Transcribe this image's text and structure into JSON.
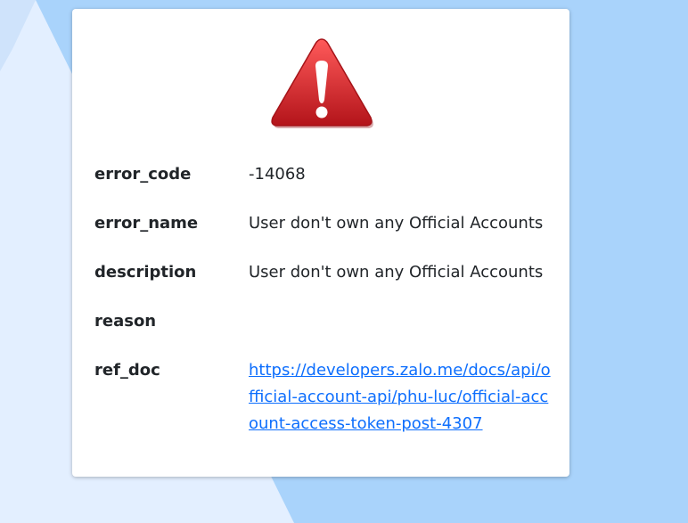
{
  "error": {
    "icon": "warning-icon",
    "rows": [
      {
        "label": "error_code",
        "value": "-14068"
      },
      {
        "label": "error_name",
        "value": "User don't own any Official Accounts"
      },
      {
        "label": "description",
        "value": "User don't own any Official Accounts"
      },
      {
        "label": "reason",
        "value": ""
      },
      {
        "label": "ref_doc",
        "value": "https://developers.zalo.me/docs/api/official-account-api/phu-luc/official-account-access-token-post-4307"
      }
    ]
  },
  "colors": {
    "background": "#a9d3fb",
    "card": "#ffffff",
    "warning": "#d3262b",
    "link": "#0d6efd"
  }
}
